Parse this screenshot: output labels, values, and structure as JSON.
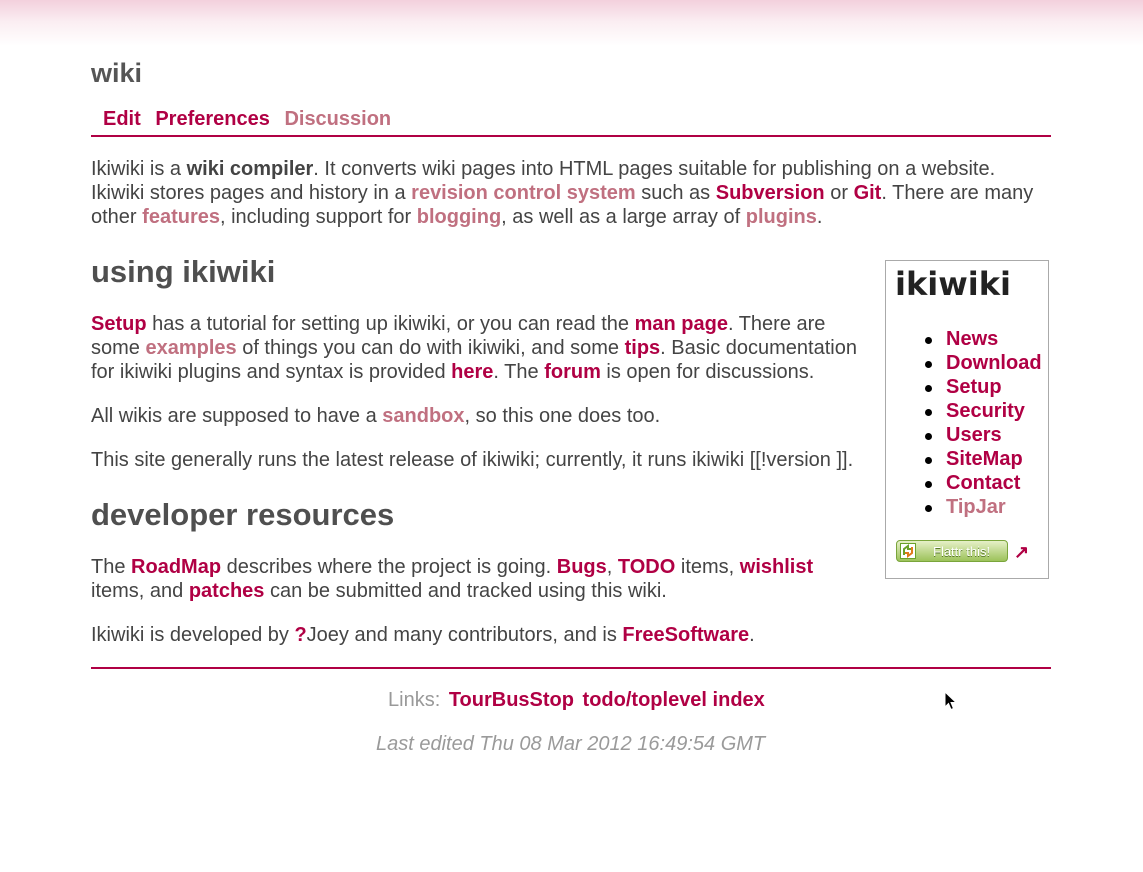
{
  "page": {
    "title": "wiki"
  },
  "actions": [
    {
      "label": "Edit"
    },
    {
      "label": "Preferences"
    },
    {
      "label": "Discussion"
    }
  ],
  "intro": {
    "t1": "Ikiwiki is a ",
    "wiki_compiler": "wiki compiler",
    "t2": ". It converts wiki pages into HTML pages suitable for publishing on a website. Ikiwiki stores pages and history in a ",
    "revision_control": "revision control system",
    "t3": " such as ",
    "subversion": "Subversion",
    "t4": " or ",
    "git": "Git",
    "t5": ". There are many other ",
    "features": "features",
    "t6": ", including support for ",
    "blogging": "blogging",
    "t7": ", as well as a large array of ",
    "plugins": "plugins",
    "t8": "."
  },
  "using": {
    "heading": "using ikiwiki",
    "p1": {
      "setup": "Setup",
      "t1": " has a tutorial for setting up ikiwiki, or you can read the ",
      "man_page": "man page",
      "t2": ". There are some ",
      "examples": "examples",
      "t3": " of things you can do with ikiwiki, and some ",
      "tips": "tips",
      "t4": ". Basic documentation for ikiwiki plugins and syntax is provided ",
      "here": "here",
      "t5": ". The ",
      "forum": "forum",
      "t6": " is open for discussions."
    },
    "p2": {
      "t1": "All wikis are supposed to have a ",
      "sandbox": "sandbox",
      "t2": ", so this one does too."
    },
    "p3": "This site generally runs the latest release of ikiwiki; currently, it runs ikiwiki [[!version ]]."
  },
  "developer": {
    "heading": "developer resources",
    "p1": {
      "t1": "The ",
      "roadmap": "RoadMap",
      "t2": " describes where the project is going. ",
      "bugs": "Bugs",
      "t3": ", ",
      "todo": "TODO",
      "t4": " items, ",
      "wishlist": "wishlist",
      "t5": " items, and ",
      "patches": "patches",
      "t6": " can be submitted and tracked using this wiki."
    },
    "p2": {
      "t1": "Ikiwiki is developed by ",
      "create_link": "?",
      "joey": "Joey",
      "t2": " and many contributors, and is ",
      "freesoftware": "FreeSoftware",
      "t3": "."
    }
  },
  "sidebar": {
    "logo_text": "ikiwiki",
    "items": [
      {
        "label": "News"
      },
      {
        "label": "Download"
      },
      {
        "label": "Setup"
      },
      {
        "label": "Security"
      },
      {
        "label": "Users"
      },
      {
        "label": "SiteMap"
      },
      {
        "label": "Contact"
      },
      {
        "label": "TipJar"
      }
    ],
    "flattr_label": "Flattr this!",
    "external_arrow": "↗"
  },
  "footer": {
    "links_label": "Links:",
    "links": [
      {
        "label": "TourBusStop"
      },
      {
        "label": "todo/toplevel index"
      }
    ],
    "last_edited": "Last edited Thu 08 Mar 2012 16:49:54 GMT"
  },
  "colors": {
    "link": "#b00044",
    "visited_link": "#c07080",
    "text": "#444444",
    "rule": "#b00044"
  },
  "icons": {
    "cursor": "mouse-pointer-icon",
    "flattr": "flattr-icon",
    "external": "external-link-icon"
  }
}
